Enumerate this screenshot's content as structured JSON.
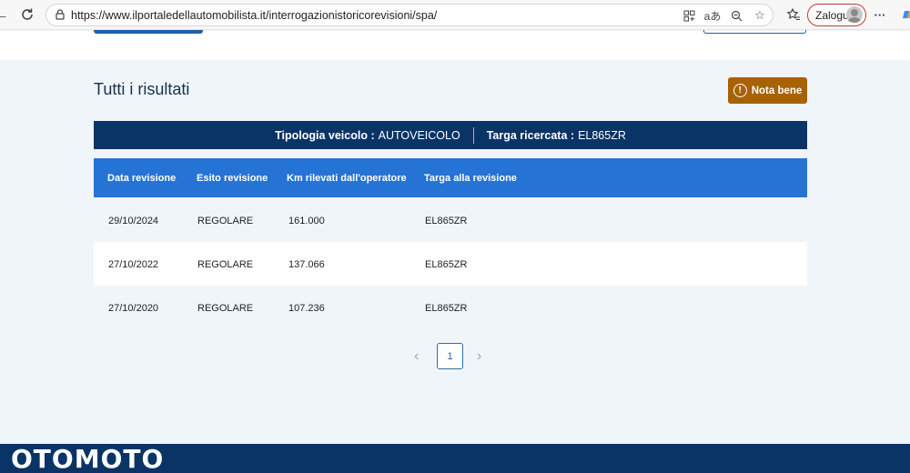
{
  "browser": {
    "url": "https://www.ilportaledellautomobilista.it/interrogazionistoricorevisioni/spa/",
    "profile_label": "Zaloguj",
    "menu_glyph": "···"
  },
  "results": {
    "title": "Tutti i risultati",
    "nota_bene_label": "Nota bene",
    "nota_bene_icon": "!"
  },
  "vehicle": {
    "type_label": "Tipologia veicolo :",
    "type_value": "AUTOVEICOLO",
    "plate_label": "Targa ricercata :",
    "plate_value": "EL865ZR"
  },
  "table": {
    "columns": [
      "Data revisione",
      "Esito revisione",
      "Km rilevati dall'operatore",
      "Targa alla revisione"
    ],
    "rows": [
      [
        "29/10/2024",
        "REGOLARE",
        "161.000",
        "EL865ZR"
      ],
      [
        "27/10/2022",
        "REGOLARE",
        "137.066",
        "EL865ZR"
      ],
      [
        "27/10/2020",
        "REGOLARE",
        "107.236",
        "EL865ZR"
      ]
    ]
  },
  "pagination": {
    "current_page": "1",
    "prev_glyph": "‹",
    "next_glyph": "›"
  },
  "watermark": "OTOMOTO"
}
